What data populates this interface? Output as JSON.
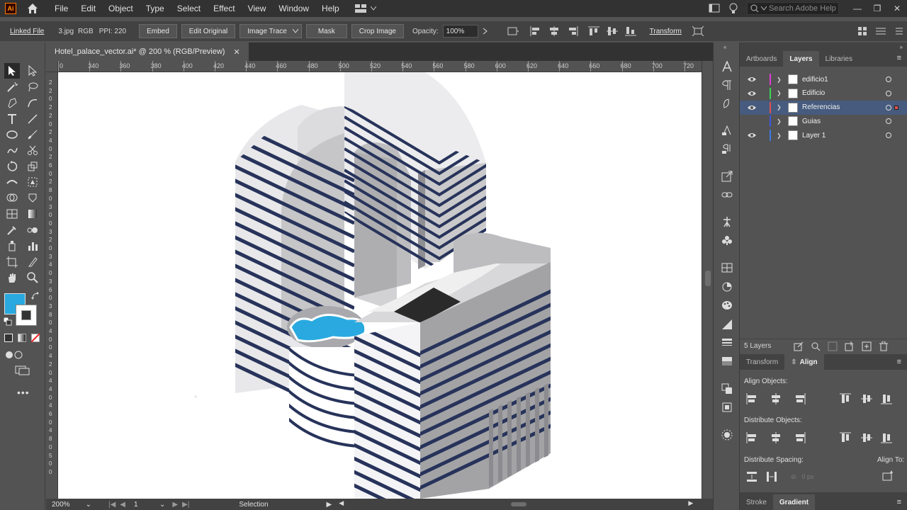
{
  "menu": {
    "logo": "Ai",
    "items": [
      "File",
      "Edit",
      "Object",
      "Type",
      "Select",
      "Effect",
      "View",
      "Window",
      "Help"
    ],
    "search_placeholder": "Search Adobe Help"
  },
  "control_bar": {
    "linked_file": "Linked File",
    "filename": "3.jpg",
    "color_mode": "RGB",
    "ppi": "PPI: 220",
    "embed": "Embed",
    "edit_original": "Edit Original",
    "image_trace": "Image Trace",
    "mask": "Mask",
    "crop_image": "Crop Image",
    "opacity_label": "Opacity:",
    "opacity_value": "100%",
    "transform": "Transform"
  },
  "document": {
    "tab_title": "Hotel_palace_vector.ai* @ 200 % (RGB/Preview)"
  },
  "ruler": {
    "h_ticks": [
      "0",
      "340",
      "360",
      "380",
      "400",
      "420",
      "440",
      "460",
      "480",
      "500",
      "520",
      "540",
      "560",
      "580",
      "600",
      "620",
      "640",
      "660",
      "680",
      "700",
      "720"
    ],
    "v_ticks": [
      "2",
      "2",
      "0",
      "2",
      "2",
      "0",
      "2",
      "4",
      "0",
      "2",
      "6",
      "0",
      "2",
      "8",
      "0",
      "3",
      "0",
      "0",
      "3",
      "2",
      "0",
      "3",
      "4",
      "0",
      "3",
      "6",
      "0",
      "3",
      "8",
      "0",
      "4",
      "0",
      "0",
      "4",
      "2",
      "0",
      "4",
      "4",
      "0",
      "4",
      "6",
      "0",
      "4",
      "8",
      "0",
      "5",
      "0",
      "0"
    ]
  },
  "status": {
    "zoom": "200%",
    "artboard": "1",
    "tool": "Selection"
  },
  "panels": {
    "top_tabs": [
      "Artboards",
      "Layers",
      "Libraries"
    ],
    "active_top_tab": "Layers",
    "layers": [
      {
        "name": "edificio1",
        "color": "#e23ad8",
        "visible": true,
        "selected": false
      },
      {
        "name": "Edificio",
        "color": "#3ad65a",
        "visible": true,
        "selected": false
      },
      {
        "name": "Referencias",
        "color": "#e25050",
        "visible": true,
        "selected": true
      },
      {
        "name": "Guias",
        "color": "#3a5ae2",
        "visible": false,
        "selected": false
      },
      {
        "name": "Layer 1",
        "color": "#3a7ae2",
        "visible": true,
        "selected": false
      }
    ],
    "layers_count": "5 Layers",
    "align_tabs": [
      "Transform",
      "Align"
    ],
    "active_align_tab": "Align",
    "align_objects": "Align Objects:",
    "distribute_objects": "Distribute Objects:",
    "distribute_spacing": "Distribute Spacing:",
    "spacing_value": "0 px",
    "align_to": "Align To:",
    "bottom_tabs": [
      "Stroke",
      "Gradient"
    ],
    "active_bottom_tab": "Gradient"
  },
  "colors": {
    "accent_fill": "#29a9e0",
    "navy_stripe": "#27335a",
    "selection_highlight": "#465b7e"
  }
}
